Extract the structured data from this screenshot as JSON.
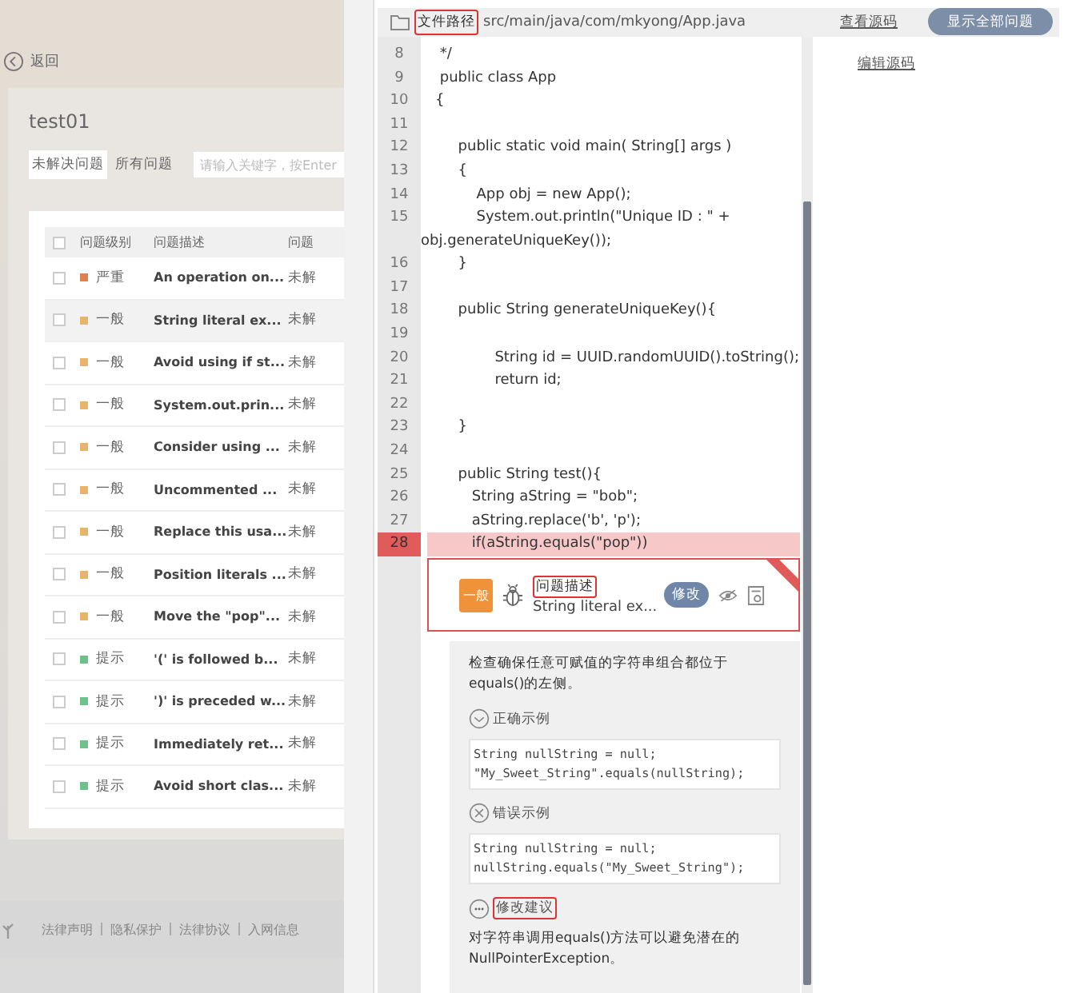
{
  "back": "返回",
  "project": "test01",
  "tabs": [
    {
      "label": "未解决问题",
      "selected": true
    },
    {
      "label": "所有问题",
      "selected": false
    }
  ],
  "search": {
    "placeholder": "请输入关键字，按Enter"
  },
  "table": {
    "all_checked": false,
    "columns": [
      "问题级别",
      "问题描述",
      "问题"
    ],
    "rows": [
      {
        "selected": false,
        "checked": false,
        "level": "严重",
        "color": "#e0804f",
        "description": "An operation on...",
        "status": "未解"
      },
      {
        "selected": true,
        "checked": false,
        "level": "一般",
        "color": "#e8b36a",
        "description": "String literal ex...",
        "status": "未解"
      },
      {
        "selected": false,
        "checked": false,
        "level": "一般",
        "color": "#e8b36a",
        "description": "Avoid using if st...",
        "status": "未解"
      },
      {
        "selected": false,
        "checked": false,
        "level": "一般",
        "color": "#e8b36a",
        "description": "System.out.prin...",
        "status": "未解"
      },
      {
        "selected": false,
        "checked": false,
        "level": "一般",
        "color": "#e8b36a",
        "description": "Consider using ...",
        "status": "未解"
      },
      {
        "selected": false,
        "checked": false,
        "level": "一般",
        "color": "#e8b36a",
        "description": "Uncommented ...",
        "status": "未解"
      },
      {
        "selected": false,
        "checked": false,
        "level": "一般",
        "color": "#e8b36a",
        "description": "Replace this usa...",
        "status": "未解"
      },
      {
        "selected": false,
        "checked": false,
        "level": "一般",
        "color": "#e8b36a",
        "description": "Position literals ...",
        "status": "未解"
      },
      {
        "selected": false,
        "checked": false,
        "level": "一般",
        "color": "#e8b36a",
        "description": "Move the \"pop\"...",
        "status": "未解"
      },
      {
        "selected": false,
        "checked": false,
        "level": "提示",
        "color": "#6cc28a",
        "description": "'(' is followed b...",
        "status": "未解"
      },
      {
        "selected": false,
        "checked": false,
        "level": "提示",
        "color": "#6cc28a",
        "description": "')' is preceded w...",
        "status": "未解"
      },
      {
        "selected": false,
        "checked": false,
        "level": "提示",
        "color": "#6cc28a",
        "description": "Immediately ret...",
        "status": "未解"
      },
      {
        "selected": false,
        "checked": false,
        "level": "提示",
        "color": "#6cc28a",
        "description": "Avoid short clas...",
        "status": "未解"
      }
    ]
  },
  "footer_links": [
    "法律声明",
    "隐私保护",
    "法律协议",
    "入网信息"
  ],
  "file_bar": {
    "label": "文件路径",
    "path": "src/main/java/com/mkyong/App.java"
  },
  "actions": {
    "view_source": "查看源码",
    "edit_source": "编辑源码",
    "show_all": "显示全部问题"
  },
  "code": [
    {
      "number": "8",
      "text": " */",
      "highlighted": false
    },
    {
      "number": "9",
      "text": " public class App",
      "highlighted": false
    },
    {
      "number": "10",
      "text": "{",
      "highlighted": false
    },
    {
      "number": "11",
      "highlighted": false
    },
    {
      "number": "12",
      "text": "     public static void main( String[] args )",
      "highlighted": false
    },
    {
      "number": "13",
      "text": "     {",
      "highlighted": false
    },
    {
      "number": "14",
      "text": "         App obj = new App();",
      "highlighted": false
    },
    {
      "number": "15",
      "text": "         System.out.println(\"Unique ID : \" +",
      "wrap": "obj.generateUniqueKey());",
      "highlighted": false
    },
    {
      "number": "16",
      "text": "     }",
      "highlighted": false
    },
    {
      "number": "17",
      "highlighted": false
    },
    {
      "number": "18",
      "text": "     public String generateUniqueKey(){",
      "highlighted": false
    },
    {
      "number": "19",
      "highlighted": false
    },
    {
      "number": "20",
      "text": "             String id = UUID.randomUUID().toString();",
      "highlighted": false
    },
    {
      "number": "21",
      "text": "             return id;",
      "highlighted": false
    },
    {
      "number": "22",
      "highlighted": false
    },
    {
      "number": "23",
      "text": "     }",
      "highlighted": false
    },
    {
      "number": "24",
      "highlighted": false
    },
    {
      "number": "25",
      "text": "     public String test(){",
      "highlighted": false
    },
    {
      "number": "26",
      "text": "        String aString = \"bob\";",
      "highlighted": false
    },
    {
      "number": "27",
      "text": "        aString.replace('b', 'p');",
      "highlighted": false
    },
    {
      "number": "28",
      "text": "        if(aString.equals(\"pop\"))",
      "highlighted": true
    }
  ],
  "issue": {
    "level": "一般",
    "title": "问题描述",
    "summary": "String literal ex...",
    "fix_button": "修改"
  },
  "detail": {
    "description": "检查确保任意可赋值的字符串组合都位于equals()的左侧。",
    "sections": [
      {
        "kind": "correct",
        "heading": "正确示例",
        "code": [
          "String nullString = null;",
          "\"My_Sweet_String\".equals(nullString);"
        ]
      },
      {
        "kind": "wrong",
        "heading": "错误示例",
        "code": [
          "String nullString = null;",
          "nullString.equals(\"My_Sweet_String\");"
        ]
      },
      {
        "kind": "suggestion",
        "heading": "修改建议",
        "text": "对字符串调用equals()方法可以避免潜在的NullPointerException。"
      }
    ]
  }
}
